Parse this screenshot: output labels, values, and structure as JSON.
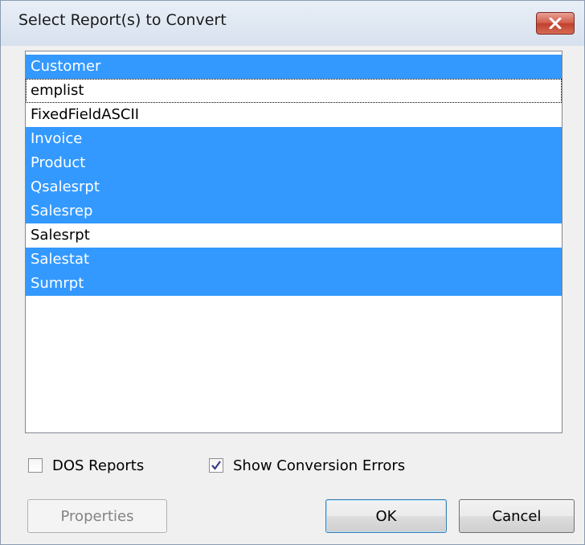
{
  "window": {
    "title": "Select Report(s) to Convert",
    "close_icon": "close-icon"
  },
  "report_list": {
    "items": [
      {
        "label": "Customer",
        "selected": true,
        "focused": false
      },
      {
        "label": "emplist",
        "selected": false,
        "focused": true
      },
      {
        "label": "FixedFieldASCII",
        "selected": false,
        "focused": false
      },
      {
        "label": "Invoice",
        "selected": true,
        "focused": false
      },
      {
        "label": "Product",
        "selected": true,
        "focused": false
      },
      {
        "label": "Qsalesrpt",
        "selected": true,
        "focused": false
      },
      {
        "label": "Salesrep",
        "selected": true,
        "focused": false
      },
      {
        "label": "Salesrpt",
        "selected": false,
        "focused": false
      },
      {
        "label": "Salestat",
        "selected": true,
        "focused": false
      },
      {
        "label": "Sumrpt",
        "selected": true,
        "focused": false
      }
    ]
  },
  "options": {
    "dos_reports": {
      "label": "DOS Reports",
      "checked": false
    },
    "show_errors": {
      "label": "Show Conversion Errors",
      "checked": true
    }
  },
  "buttons": {
    "properties": {
      "label": "Properties",
      "enabled": false
    },
    "ok": {
      "label": "OK",
      "enabled": true
    },
    "cancel": {
      "label": "Cancel",
      "enabled": true
    }
  },
  "colors": {
    "selection": "#3399ff",
    "close_button": "#c0402c"
  }
}
